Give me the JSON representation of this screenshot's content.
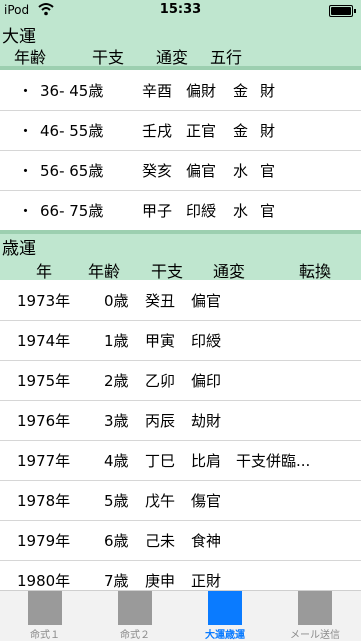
{
  "status": {
    "carrier": "iPod",
    "time": "15:33"
  },
  "daiun": {
    "title": "大運",
    "headers": [
      "年齢",
      "干支",
      "通変",
      "五行"
    ],
    "rows": [
      {
        "bullet": "・",
        "age": "36- 45歳",
        "kanshi": "辛酉",
        "tsuhen": "偏財",
        "gogyo1": "金",
        "gogyo2": "財"
      },
      {
        "bullet": "・",
        "age": "46- 55歳",
        "kanshi": "壬戌",
        "tsuhen": "正官",
        "gogyo1": "金",
        "gogyo2": "財"
      },
      {
        "bullet": "・",
        "age": "56- 65歳",
        "kanshi": "癸亥",
        "tsuhen": "偏官",
        "gogyo1": "水",
        "gogyo2": "官"
      },
      {
        "bullet": "・",
        "age": "66- 75歳",
        "kanshi": "甲子",
        "tsuhen": "印綬",
        "gogyo1": "水",
        "gogyo2": "官"
      }
    ]
  },
  "saiun": {
    "title": "歳運",
    "headers": [
      "年",
      "年齢",
      "干支",
      "通変",
      "転換"
    ],
    "rows": [
      {
        "year": "1973年",
        "age": "0歳",
        "kanshi": "癸丑",
        "tsuhen": "偏官",
        "tenkan": ""
      },
      {
        "year": "1974年",
        "age": "1歳",
        "kanshi": "甲寅",
        "tsuhen": "印綬",
        "tenkan": ""
      },
      {
        "year": "1975年",
        "age": "2歳",
        "kanshi": "乙卯",
        "tsuhen": "偏印",
        "tenkan": ""
      },
      {
        "year": "1976年",
        "age": "3歳",
        "kanshi": "丙辰",
        "tsuhen": "劫財",
        "tenkan": ""
      },
      {
        "year": "1977年",
        "age": "4歳",
        "kanshi": "丁巳",
        "tsuhen": "比肩",
        "tenkan": "干支併臨..."
      },
      {
        "year": "1978年",
        "age": "5歳",
        "kanshi": "戊午",
        "tsuhen": "傷官",
        "tenkan": ""
      },
      {
        "year": "1979年",
        "age": "6歳",
        "kanshi": "己未",
        "tsuhen": "食神",
        "tenkan": ""
      },
      {
        "year": "1980年",
        "age": "7歳",
        "kanshi": "庚申",
        "tsuhen": "正財",
        "tenkan": ""
      }
    ]
  },
  "tabs": [
    {
      "label": "命式１",
      "active": false
    },
    {
      "label": "命式２",
      "active": false
    },
    {
      "label": "大運歳運",
      "active": true
    },
    {
      "label": "メール送信",
      "active": false
    }
  ]
}
